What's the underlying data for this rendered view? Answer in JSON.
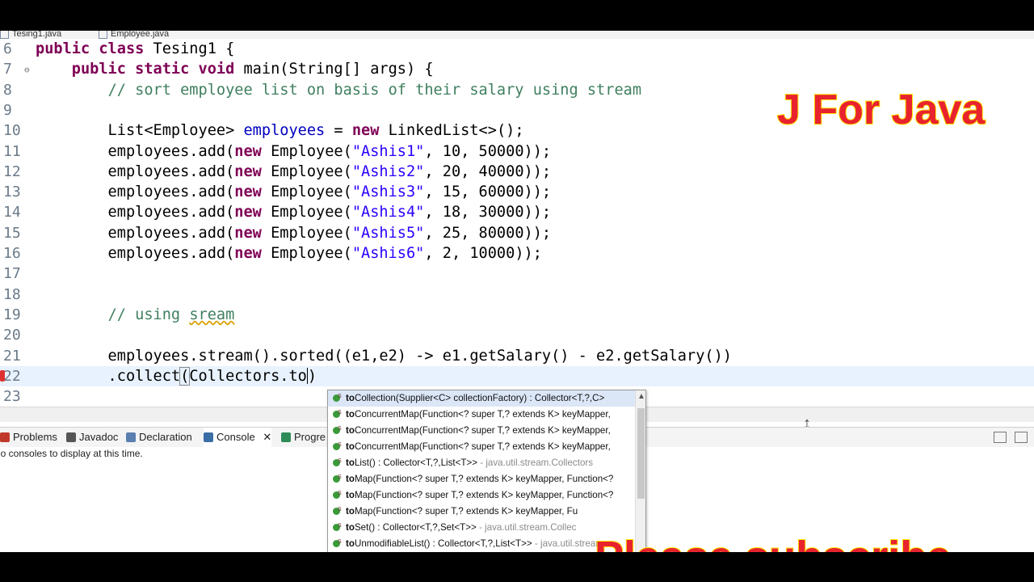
{
  "editor_tabs": [
    {
      "label": "Tesing1.java"
    },
    {
      "label": "Employee.java"
    }
  ],
  "code_lines": [
    {
      "num": "6",
      "segments": [
        [
          "kw",
          "public class "
        ],
        [
          "",
          "Tesing1 {"
        ]
      ]
    },
    {
      "num": "7",
      "segments": [
        [
          "",
          "    "
        ],
        [
          "kw",
          "public static void "
        ],
        [
          "",
          "main(String[] args) {"
        ]
      ]
    },
    {
      "num": "8",
      "segments": [
        [
          "",
          "        "
        ],
        [
          "cm",
          "// sort employee list on basis of their salary using stream"
        ]
      ]
    },
    {
      "num": "9",
      "segments": []
    },
    {
      "num": "10",
      "segments": [
        [
          "",
          "        List<Employee> "
        ],
        [
          "fld",
          "employees"
        ],
        [
          "",
          " = "
        ],
        [
          "kw",
          "new "
        ],
        [
          "",
          "LinkedList<>();"
        ]
      ]
    },
    {
      "num": "11",
      "segments": [
        [
          "",
          "        employees.add("
        ],
        [
          "kw",
          "new "
        ],
        [
          "",
          "Employee("
        ],
        [
          "st",
          "\"Ashis1\""
        ],
        [
          "",
          ", 10, 50000));"
        ]
      ]
    },
    {
      "num": "12",
      "segments": [
        [
          "",
          "        employees.add("
        ],
        [
          "kw",
          "new "
        ],
        [
          "",
          "Employee("
        ],
        [
          "st",
          "\"Ashis2\""
        ],
        [
          "",
          ", 20, 40000));"
        ]
      ]
    },
    {
      "num": "13",
      "segments": [
        [
          "",
          "        employees.add("
        ],
        [
          "kw",
          "new "
        ],
        [
          "",
          "Employee("
        ],
        [
          "st",
          "\"Ashis3\""
        ],
        [
          "",
          ", 15, 60000));"
        ]
      ]
    },
    {
      "num": "14",
      "segments": [
        [
          "",
          "        employees.add("
        ],
        [
          "kw",
          "new "
        ],
        [
          "",
          "Employee("
        ],
        [
          "st",
          "\"Ashis4\""
        ],
        [
          "",
          ", 18, 30000));"
        ]
      ]
    },
    {
      "num": "15",
      "segments": [
        [
          "",
          "        employees.add("
        ],
        [
          "kw",
          "new "
        ],
        [
          "",
          "Employee("
        ],
        [
          "st",
          "\"Ashis5\""
        ],
        [
          "",
          ", 25, 80000));"
        ]
      ]
    },
    {
      "num": "16",
      "segments": [
        [
          "",
          "        employees.add("
        ],
        [
          "kw",
          "new "
        ],
        [
          "",
          "Employee("
        ],
        [
          "st",
          "\"Ashis6\""
        ],
        [
          "",
          ", 2, 10000));"
        ]
      ]
    },
    {
      "num": "17",
      "segments": []
    },
    {
      "num": "18",
      "segments": []
    },
    {
      "num": "19",
      "segments": [
        [
          "",
          "        "
        ],
        [
          "cm",
          "// using "
        ],
        [
          "cm squig",
          "sream"
        ]
      ]
    },
    {
      "num": "20",
      "segments": []
    },
    {
      "num": "21",
      "segments": [
        [
          "",
          "        employees.stream().sorted((e1,e2) -> e1.getSalary() - e2.getSalary())"
        ]
      ]
    },
    {
      "num": "22",
      "segments": [
        [
          "",
          "        .collect"
        ],
        [
          "bracket",
          "("
        ],
        [
          "",
          "Collectors.to"
        ],
        [
          "caret",
          ""
        ],
        [
          "",
          ")"
        ]
      ]
    },
    {
      "num": "23",
      "segments": []
    }
  ],
  "view_tabs": [
    {
      "label": "Problems",
      "icon": "problems-icon",
      "color": "#c0392b"
    },
    {
      "label": "Javadoc",
      "icon": "javadoc-icon",
      "color": "#555555"
    },
    {
      "label": "Declaration",
      "icon": "declaration-icon",
      "color": "#5a7fb0"
    },
    {
      "label": "Console",
      "icon": "console-icon",
      "color": "#3b6ea5"
    },
    {
      "label": "Progre",
      "icon": "progress-icon",
      "color": "#2e8b57"
    }
  ],
  "console_message": "lo consoles to display at this time.",
  "content_assist": [
    {
      "bold": "to",
      "rest": "Collection(Supplier<C> collectionFactory) : Collector<T,?,C>",
      "gray": ""
    },
    {
      "bold": "to",
      "rest": "ConcurrentMap(Function<? super T,? extends K> keyMapper,",
      "gray": ""
    },
    {
      "bold": "to",
      "rest": "ConcurrentMap(Function<? super T,? extends K> keyMapper,",
      "gray": ""
    },
    {
      "bold": "to",
      "rest": "ConcurrentMap(Function<? super T,? extends K> keyMapper,",
      "gray": ""
    },
    {
      "bold": "to",
      "rest": "List() : Collector<T,?,List<T>> ",
      "gray": "- java.util.stream.Collectors"
    },
    {
      "bold": "to",
      "rest": "Map(Function<? super T,? extends K> keyMapper, Function<?",
      "gray": ""
    },
    {
      "bold": "to",
      "rest": "Map(Function<? super T,? extends K> keyMapper, Function<?",
      "gray": ""
    },
    {
      "bold": "to",
      "rest": "Map(Function<? super T,? extends K> keyMapper, Fu",
      "gray": ""
    },
    {
      "bold": "to",
      "rest": "Set() : Collector<T,?,Set<T>> ",
      "gray": "- java.util.stream.Collec"
    },
    {
      "bold": "to",
      "rest": "UnmodifiableList() : Collector<T,?,List<T>> ",
      "gray": "- java.util.stream"
    }
  ],
  "overlay": {
    "brand": "J For Java",
    "subscribe": "Please subscribe"
  }
}
